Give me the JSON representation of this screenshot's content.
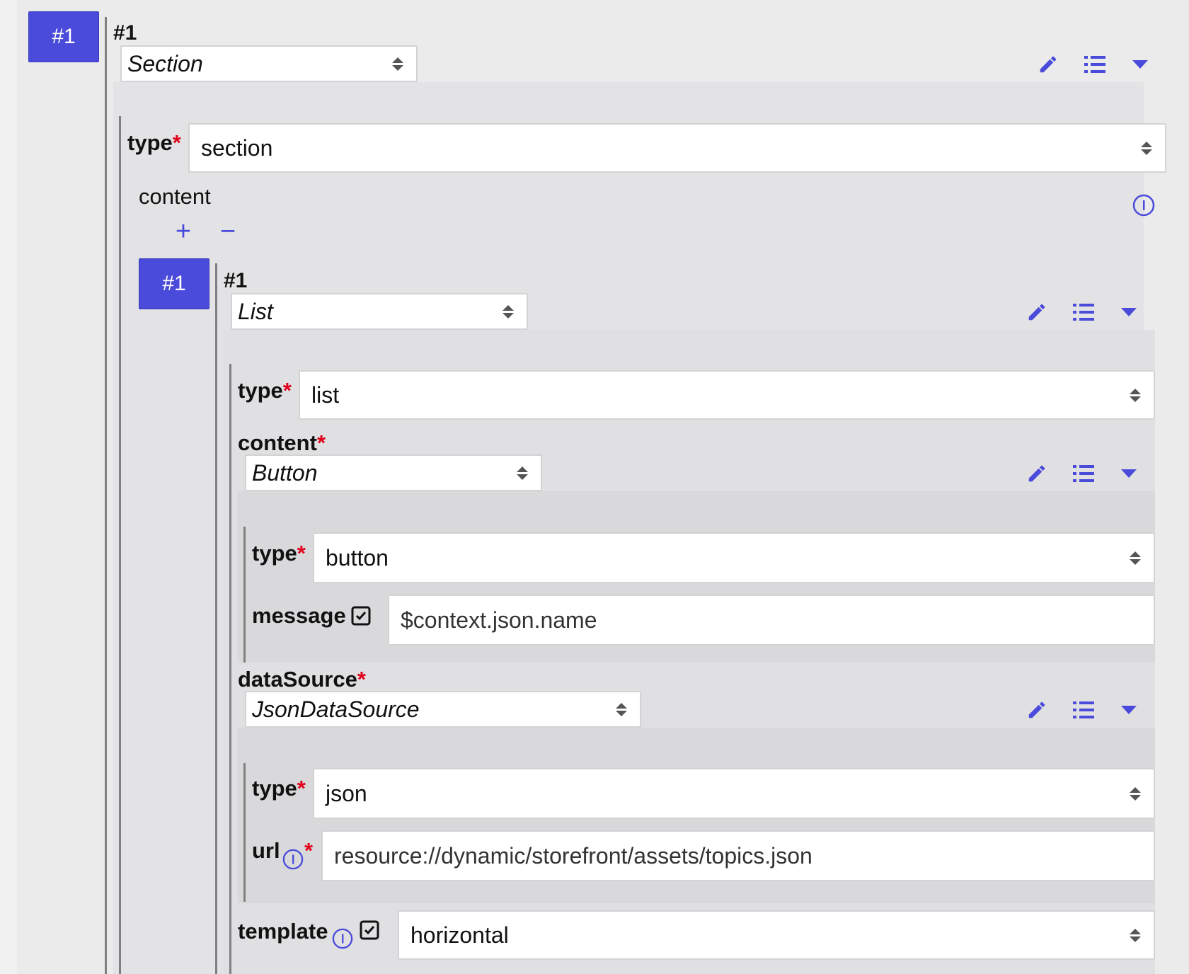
{
  "root": {
    "index_button": "#1",
    "heading": "#1",
    "kind_select": "Section",
    "type": {
      "label": "type",
      "required_mark": "*",
      "value": "section"
    },
    "content": {
      "label": "content",
      "add_symbol": "+",
      "remove_symbol": "−",
      "item": {
        "index_button": "#1",
        "heading": "#1",
        "kind_select": "List",
        "type": {
          "label": "type",
          "required_mark": "*",
          "value": "list"
        },
        "content": {
          "label": "content",
          "required_mark": "*",
          "kind_select": "Button",
          "type": {
            "label": "type",
            "required_mark": "*",
            "value": "button"
          },
          "message": {
            "label": "message",
            "value": "$context.json.name",
            "checked": true
          }
        },
        "dataSource": {
          "label": "dataSource",
          "required_mark": "*",
          "kind_select": "JsonDataSource",
          "type": {
            "label": "type",
            "required_mark": "*",
            "value": "json"
          },
          "url": {
            "label": "url",
            "required_mark": "*",
            "value": "resource://dynamic/storefront/assets/topics.json"
          }
        },
        "template": {
          "label": "template",
          "value": "horizontal",
          "checked": true
        }
      }
    }
  },
  "icons": {
    "edit": "pencil-icon",
    "list": "list-icon",
    "collapse": "caret-down-icon",
    "info": "info-icon"
  },
  "colors": {
    "accent": "#4b4bdb",
    "required": "#e0001b",
    "guide_line": "#808080"
  }
}
